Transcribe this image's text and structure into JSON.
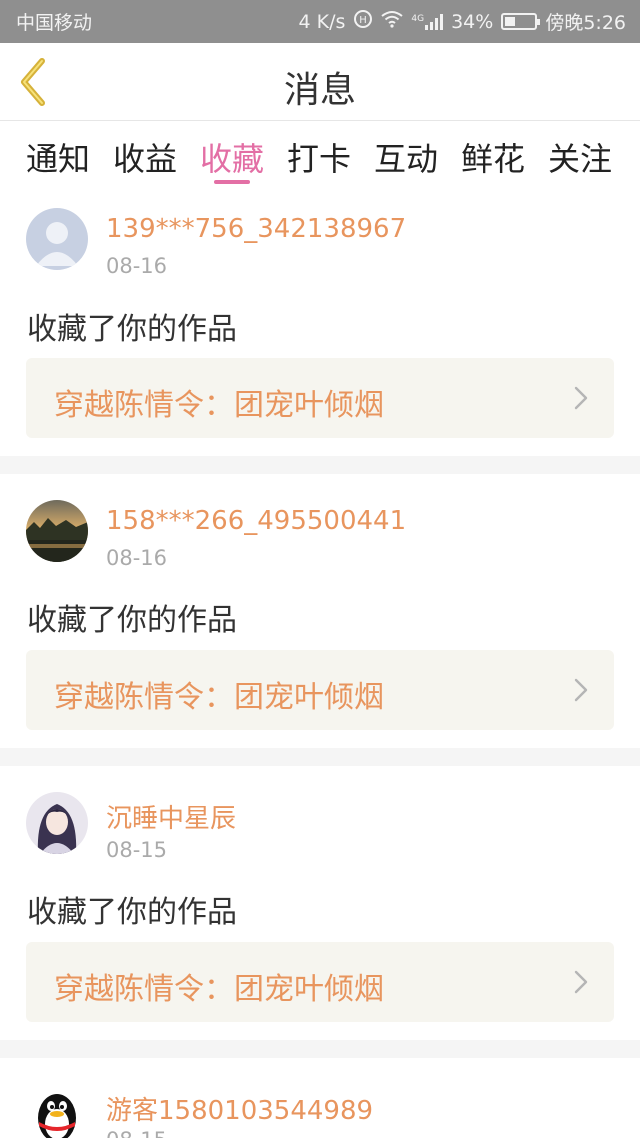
{
  "status_bar": {
    "carrier": "中国移动",
    "speed": "4 K/s",
    "network": "4G",
    "battery": "34%",
    "battery_level": 0.34,
    "time": "傍晚5:26"
  },
  "header": {
    "title": "消息"
  },
  "tabs": [
    {
      "label": "通知",
      "active": false
    },
    {
      "label": "收益",
      "active": false
    },
    {
      "label": "收藏",
      "active": true
    },
    {
      "label": "打卡",
      "active": false
    },
    {
      "label": "互动",
      "active": false
    },
    {
      "label": "鲜花",
      "active": false
    },
    {
      "label": "关注",
      "active": false
    }
  ],
  "messages": [
    {
      "username": "139***756_342138967",
      "date": "08-16",
      "action": "收藏了你的作品",
      "work_title": "穿越陈情令：团宠叶倾烟",
      "avatar": "default-avatar"
    },
    {
      "username": "158***266_495500441",
      "date": "08-16",
      "action": "收藏了你的作品",
      "work_title": "穿越陈情令：团宠叶倾烟",
      "avatar": "landscape-avatar"
    },
    {
      "username": "沉睡中星辰",
      "date": "08-15",
      "action": "收藏了你的作品",
      "work_title": "穿越陈情令：团宠叶倾烟",
      "avatar": "anime-avatar"
    },
    {
      "username": "游客1580103544989",
      "date": "08-15",
      "action": "",
      "work_title": "",
      "avatar": "qq-penguin-avatar"
    }
  ],
  "colors": {
    "accent": "#e36fa5",
    "username": "#e8955e",
    "work_box_bg": "#f6f5ef"
  }
}
